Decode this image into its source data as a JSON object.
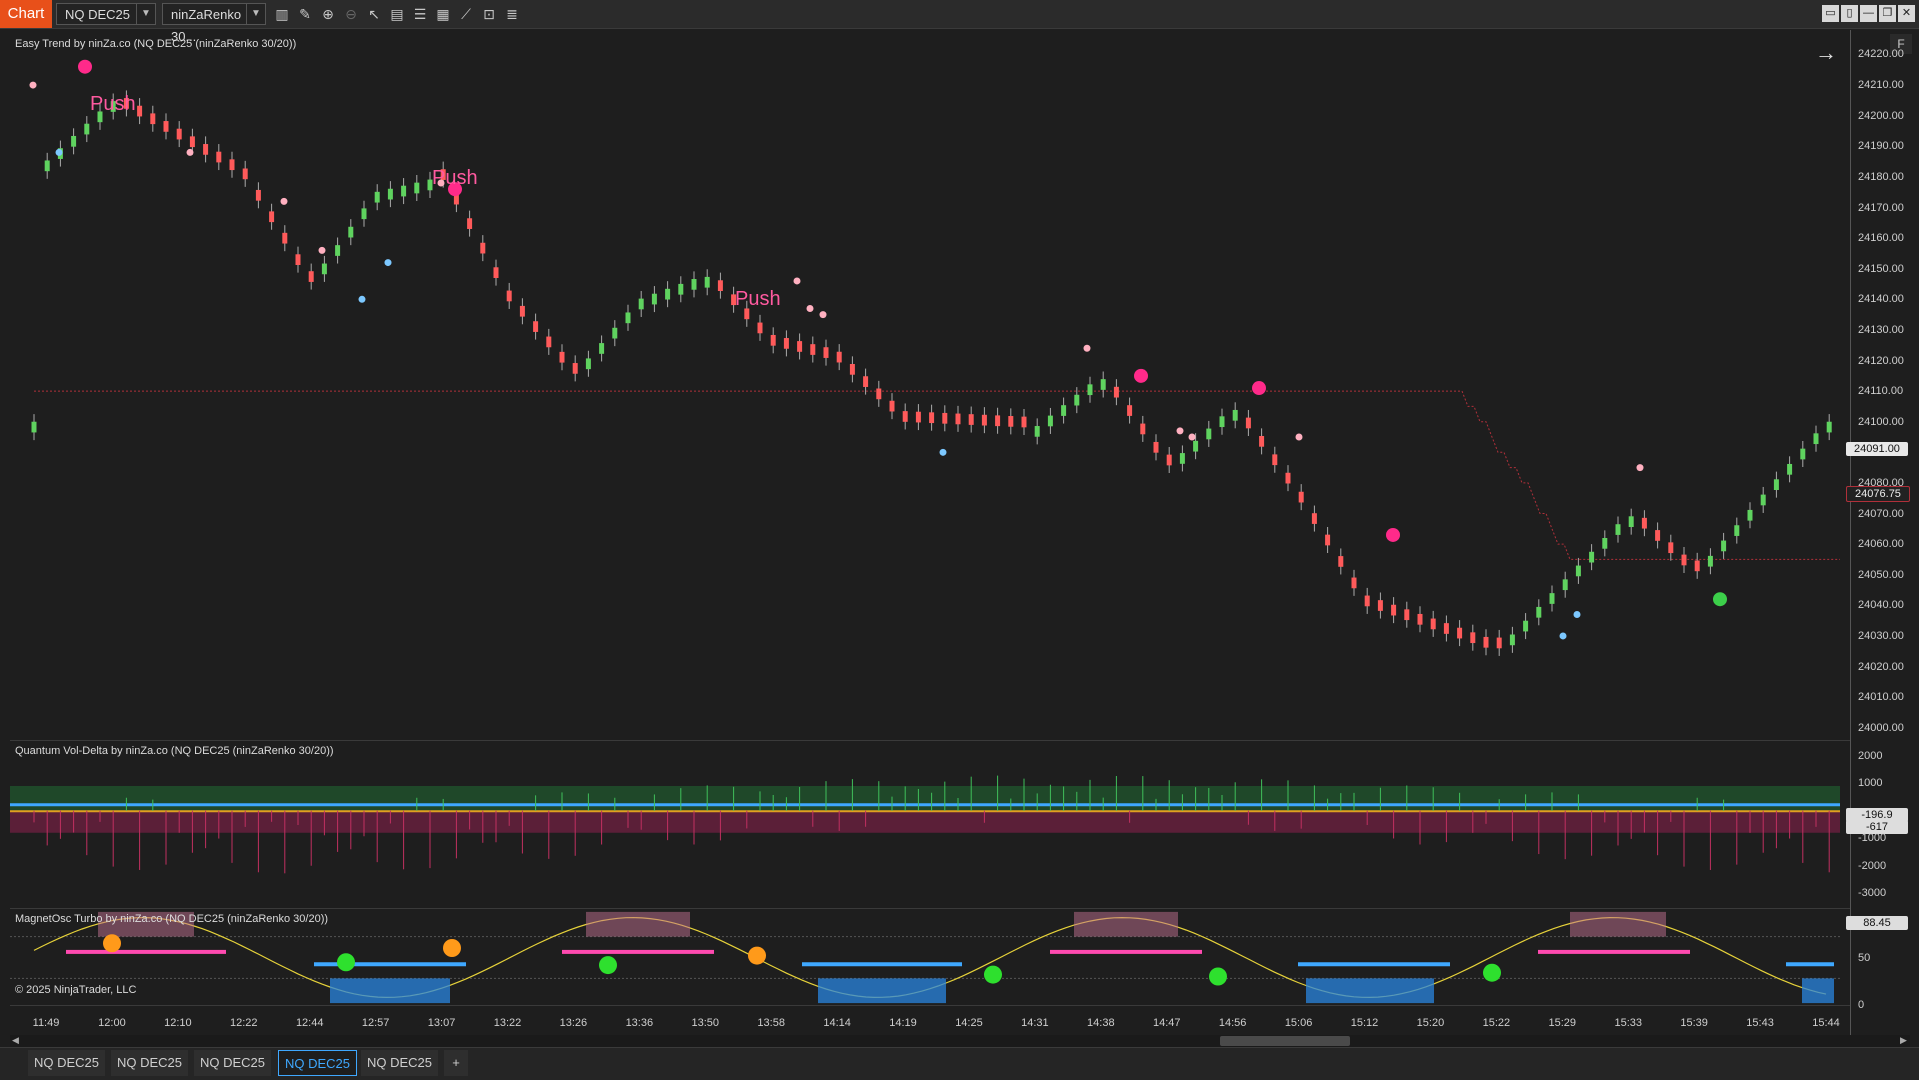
{
  "toolbar": {
    "chart_tab": "Chart",
    "instrument": "NQ DEC25",
    "bar_type": "ninZaRenko 30...",
    "tools": [
      "bar-chart-icon",
      "pencil-icon",
      "zoom-in-icon",
      "zoom-out-icon",
      "pointer-icon",
      "data-box-icon",
      "properties-icon",
      "templates-icon",
      "strategy-icon",
      "indicators-icon",
      "list-icon"
    ],
    "window_buttons": [
      "▭",
      "▯",
      "—",
      "❐",
      "✕"
    ]
  },
  "panes": {
    "price": {
      "label": "Easy Trend by ninZa.co (NQ DEC25 (ninZaRenko 30/20))",
      "f_button": "F",
      "arrow": "→"
    },
    "voldelta": {
      "label": "Quantum Vol-Delta by ninZa.co (NQ DEC25 (ninZaRenko 30/20))"
    },
    "magnet": {
      "label": "MagnetOsc Turbo by ninZa.co (NQ DEC25 (ninZaRenko 30/20))"
    }
  },
  "copyright": "© 2025 NinjaTrader, LLC",
  "price_axis": {
    "ticks": [
      "24220.00",
      "24210.00",
      "24200.00",
      "24190.00",
      "24180.00",
      "24170.00",
      "24160.00",
      "24150.00",
      "24140.00",
      "24130.00",
      "24120.00",
      "24110.00",
      "24100.00",
      "24090.00",
      "24080.00",
      "24070.00",
      "24060.00",
      "24050.00",
      "24040.00",
      "24030.00",
      "24020.00",
      "24010.00",
      "24000.00"
    ],
    "current_price": "24091.00",
    "stop_price": "24076.75"
  },
  "voldelta_axis": {
    "ticks": [
      "2000",
      "1000",
      "-1000",
      "-2000",
      "-3000"
    ],
    "value1": "-196.9",
    "value2": "-617"
  },
  "magnet_axis": {
    "ticks": [
      "50",
      "0"
    ],
    "value": "88.45"
  },
  "time_axis": [
    "11:49",
    "12:00",
    "12:10",
    "12:22",
    "12:44",
    "12:57",
    "13:07",
    "13:22",
    "13:26",
    "13:36",
    "13:50",
    "13:58",
    "14:14",
    "14:19",
    "14:25",
    "14:31",
    "14:38",
    "14:47",
    "14:56",
    "15:06",
    "15:12",
    "15:20",
    "15:22",
    "15:29",
    "15:33",
    "15:39",
    "15:43",
    "15:44"
  ],
  "push_labels": [
    "Push",
    "Push",
    "Push"
  ],
  "bottom_tabs": [
    "NQ DEC25",
    "NQ DEC25",
    "NQ DEC25",
    "NQ DEC25",
    "NQ DEC25"
  ],
  "active_tab_index": 3,
  "add_tab": "+",
  "colors": {
    "up": "#5fd35f",
    "down": "#ff5a5a",
    "trail": "#b0303a",
    "push": "#ff2a8a",
    "accent_tab": "#e8501a"
  },
  "chart_data": [
    {
      "type": "candlestick",
      "title": "Easy Trend by ninZa.co (NQ DEC25 (ninZaRenko 30/20))",
      "close_path_x": [
        "11:49",
        "12:00",
        "12:22",
        "12:44",
        "12:57",
        "13:07",
        "13:22",
        "13:26",
        "13:36",
        "13:50",
        "13:58",
        "14:14",
        "14:19",
        "14:31",
        "14:38",
        "14:47",
        "14:56",
        "15:06",
        "15:12",
        "15:22",
        "15:33",
        "15:39",
        "15:44"
      ],
      "close_path_y": [
        24185,
        24205,
        24180,
        24145,
        24175,
        24180,
        24140,
        24115,
        24140,
        24148,
        24125,
        24120,
        24100,
        24098,
        24115,
        24085,
        24105,
        24075,
        24040,
        24025,
        24070,
        24050,
        24100
      ],
      "last": 24091.0,
      "trail_stop": 24076.75,
      "ylim": [
        23996,
        24228
      ]
    },
    {
      "type": "bar",
      "title": "Quantum Vol-Delta by ninZa.co (NQ DEC25 (ninZaRenko 30/20))",
      "ylim": [
        -3500,
        2500
      ],
      "values": [
        -196.9,
        -617
      ]
    },
    {
      "type": "line",
      "title": "MagnetOsc Turbo by ninZa.co (NQ DEC25 (ninZaRenko 30/20))",
      "ylim": [
        0,
        100
      ],
      "last": 88.45
    }
  ]
}
